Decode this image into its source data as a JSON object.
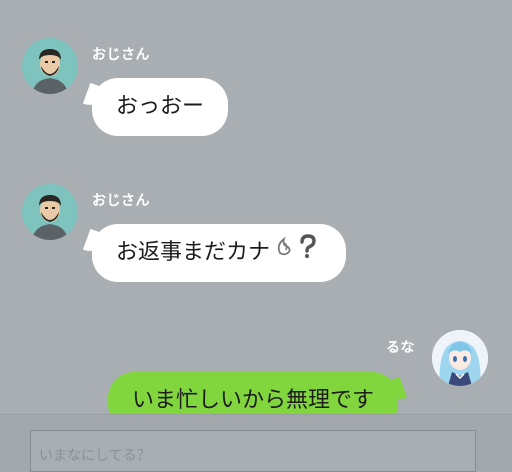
{
  "messages": [
    {
      "sender": "おじさん",
      "text": "おっおー",
      "direction": "incoming"
    },
    {
      "sender": "おじさん",
      "text": "お返事まだカナ",
      "emoji": "sweat-question",
      "direction": "incoming"
    },
    {
      "sender": "るな",
      "text": "いま忙しいから無理です",
      "direction": "outgoing"
    }
  ],
  "input": {
    "placeholder": "いまなにしてる？"
  },
  "colors": {
    "background": "#a9aeb2",
    "incoming_bubble": "#ffffff",
    "outgoing_bubble": "#82d63d",
    "sender_name": "#ffffff"
  },
  "icons": {
    "uncle_avatar": "man-avatar-icon",
    "luna_avatar": "anime-girl-avatar-icon",
    "emoji": "sweat-drop-question-icon"
  }
}
